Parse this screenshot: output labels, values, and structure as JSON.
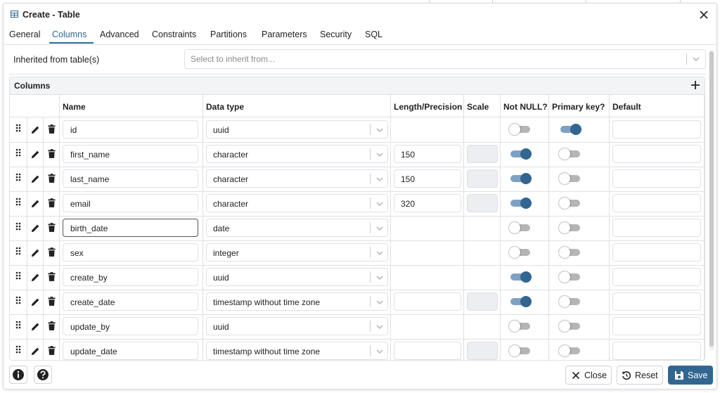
{
  "dialog": {
    "title": "Create - Table",
    "close_icon": "close-icon",
    "tabs": [
      {
        "label": "General"
      },
      {
        "label": "Columns"
      },
      {
        "label": "Advanced"
      },
      {
        "label": "Constraints"
      },
      {
        "label": "Partitions"
      },
      {
        "label": "Parameters"
      },
      {
        "label": "Security"
      },
      {
        "label": "SQL"
      }
    ],
    "active_tab": "Columns"
  },
  "inherit": {
    "label": "Inherited from table(s)",
    "placeholder": "Select to inherit from..."
  },
  "columns_panel": {
    "title": "Columns",
    "headers": {
      "name": "Name",
      "data_type": "Data type",
      "length": "Length/Precision",
      "scale": "Scale",
      "not_null": "Not NULL?",
      "primary_key": "Primary key?",
      "default": "Default"
    },
    "rows": [
      {
        "name": "id",
        "data_type": "uuid",
        "length": null,
        "scale_enabled": false,
        "not_null": false,
        "primary_key": true
      },
      {
        "name": "first_name",
        "data_type": "character",
        "length": "150",
        "scale_enabled": true,
        "not_null": true,
        "primary_key": false
      },
      {
        "name": "last_name",
        "data_type": "character",
        "length": "150",
        "scale_enabled": true,
        "not_null": true,
        "primary_key": false
      },
      {
        "name": "email",
        "data_type": "character",
        "length": "320",
        "scale_enabled": true,
        "not_null": true,
        "primary_key": false
      },
      {
        "name": "birth_date",
        "data_type": "date",
        "length": null,
        "scale_enabled": false,
        "not_null": false,
        "primary_key": false,
        "focused": true
      },
      {
        "name": "sex",
        "data_type": "integer",
        "length": null,
        "scale_enabled": false,
        "not_null": false,
        "primary_key": false
      },
      {
        "name": "create_by",
        "data_type": "uuid",
        "length": null,
        "scale_enabled": false,
        "not_null": true,
        "primary_key": false
      },
      {
        "name": "create_date",
        "data_type": "timestamp without time zone",
        "length": "",
        "scale_enabled": true,
        "not_null": true,
        "primary_key": false
      },
      {
        "name": "update_by",
        "data_type": "uuid",
        "length": null,
        "scale_enabled": false,
        "not_null": false,
        "primary_key": false
      },
      {
        "name": "update_date",
        "data_type": "timestamp without time zone",
        "length": "",
        "scale_enabled": true,
        "not_null": false,
        "primary_key": false
      }
    ]
  },
  "footer": {
    "close_label": "Close",
    "reset_label": "Reset",
    "save_label": "Save"
  },
  "colors": {
    "accent": "#326690",
    "toggle_on_track": "#7ea1c3",
    "toggle_off_track": "#b5b5b5"
  }
}
